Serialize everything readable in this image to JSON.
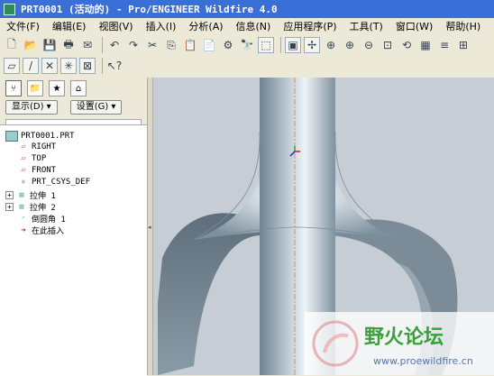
{
  "window": {
    "title": "PRT0001 (活动的) - Pro/ENGINEER Wildfire 4.0"
  },
  "menu": [
    "文件(F)",
    "编辑(E)",
    "视图(V)",
    "插入(I)",
    "分析(A)",
    "信息(N)",
    "应用程序(P)",
    "工具(T)",
    "窗口(W)",
    "帮助(H)"
  ],
  "toolbar1": [
    {
      "name": "new-icon",
      "glyph": "🗋"
    },
    {
      "name": "open-icon",
      "glyph": "📂"
    },
    {
      "name": "save-icon",
      "glyph": "💾"
    },
    {
      "name": "print-icon",
      "glyph": "🖶"
    },
    {
      "name": "email-icon",
      "glyph": "✉"
    },
    {
      "name": "sep"
    },
    {
      "name": "undo-icon",
      "glyph": "↶"
    },
    {
      "name": "redo-icon",
      "glyph": "↷"
    },
    {
      "name": "cut-icon",
      "glyph": "✂"
    },
    {
      "name": "copy-icon",
      "glyph": "⎘"
    },
    {
      "name": "paste-icon",
      "glyph": "📋"
    },
    {
      "name": "paste-special-icon",
      "glyph": "📄"
    },
    {
      "name": "regenerate-icon",
      "glyph": "⚙"
    },
    {
      "name": "find-icon",
      "glyph": "🔭"
    },
    {
      "name": "select-box-icon",
      "glyph": "⬚"
    },
    {
      "name": "sep"
    },
    {
      "name": "repaint-icon",
      "glyph": "▣"
    },
    {
      "name": "spin-center-icon",
      "glyph": "✢"
    },
    {
      "name": "orient-icon",
      "glyph": "⊕"
    },
    {
      "name": "zoom-in-icon",
      "glyph": "⊕"
    },
    {
      "name": "zoom-out-icon",
      "glyph": "⊖"
    },
    {
      "name": "refit-icon",
      "glyph": "⊡"
    },
    {
      "name": "reorient-icon",
      "glyph": "⟲"
    },
    {
      "name": "saved-views-icon",
      "glyph": "▦"
    },
    {
      "name": "layers-icon",
      "glyph": "≡"
    },
    {
      "name": "view-manager-icon",
      "glyph": "⊞"
    }
  ],
  "toolbar2": [
    {
      "name": "datum-plane-display-icon",
      "glyph": "▱"
    },
    {
      "name": "datum-axis-display-icon",
      "glyph": "/"
    },
    {
      "name": "datum-point-display-icon",
      "glyph": "✕"
    },
    {
      "name": "csys-display-icon",
      "glyph": "✳"
    },
    {
      "name": "annotation-display-icon",
      "glyph": "⊠"
    },
    {
      "name": "sep"
    },
    {
      "name": "context-help-icon",
      "glyph": "↖?"
    }
  ],
  "panel": {
    "show_button": "显示(D) ▾",
    "settings_button": "设置(G) ▾"
  },
  "tree": {
    "root": "PRT0001.PRT",
    "items": [
      "RIGHT",
      "TOP",
      "FRONT",
      "PRT_CSYS_DEF",
      "拉伸 1",
      "拉伸 2",
      "倒圆角 1",
      "在此插入"
    ]
  },
  "watermark": {
    "text": "野火论坛",
    "url": "www.proewildfire.cn"
  },
  "colors": {
    "titlebar": "#3a6fd8",
    "viewport_bg": "#c6cdd4",
    "model": "#8fa3b3"
  }
}
